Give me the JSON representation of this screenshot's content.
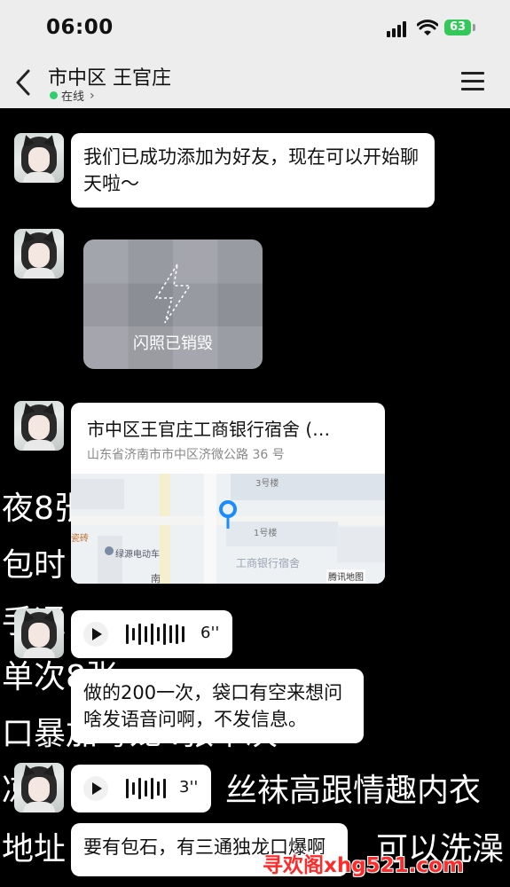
{
  "status_bar": {
    "time": "06:00",
    "battery": "63"
  },
  "header": {
    "title": "市中区 王官庄",
    "status": "在线",
    "status_color": "#2ed06e"
  },
  "background_lines": [
    {
      "text": "夜8张"
    },
    {
      "text": "包时"
    },
    {
      "text": "手通"
    },
    {
      "text": "单次8张"
    },
    {
      "text": "口暴加毒龙4张草决"
    },
    {
      "text": "凉"
    },
    {
      "text": "丝袜高跟情趣内衣"
    },
    {
      "text": "地址"
    },
    {
      "text": "可以洗澡"
    }
  ],
  "messages": [
    {
      "type": "text",
      "text": "我们已成功添加为好友，现在可以开始聊天啦～"
    },
    {
      "type": "flash_photo",
      "label": "闪照已销毁"
    },
    {
      "type": "location",
      "title": "市中区王官庄工商银行宿舍 (…",
      "address": "山东省济南市市中区济微公路 36 号",
      "map_labels": {
        "b3": "3号楼",
        "b1": "1号楼",
        "bank": "工商银行宿舍",
        "ev": "绿源电动车",
        "tile": "瓷砖",
        "south": "南",
        "brand": "腾讯地图"
      }
    },
    {
      "type": "voice",
      "duration": "6''"
    },
    {
      "type": "text",
      "text": "做的200一次，袋口有空来想问啥发语音问啊，不发信息。"
    },
    {
      "type": "voice",
      "duration": "3''"
    },
    {
      "type": "text",
      "text": "要有包石，有三通独龙口爆啊"
    }
  ],
  "watermark": "寻欢阁xhg521.com"
}
